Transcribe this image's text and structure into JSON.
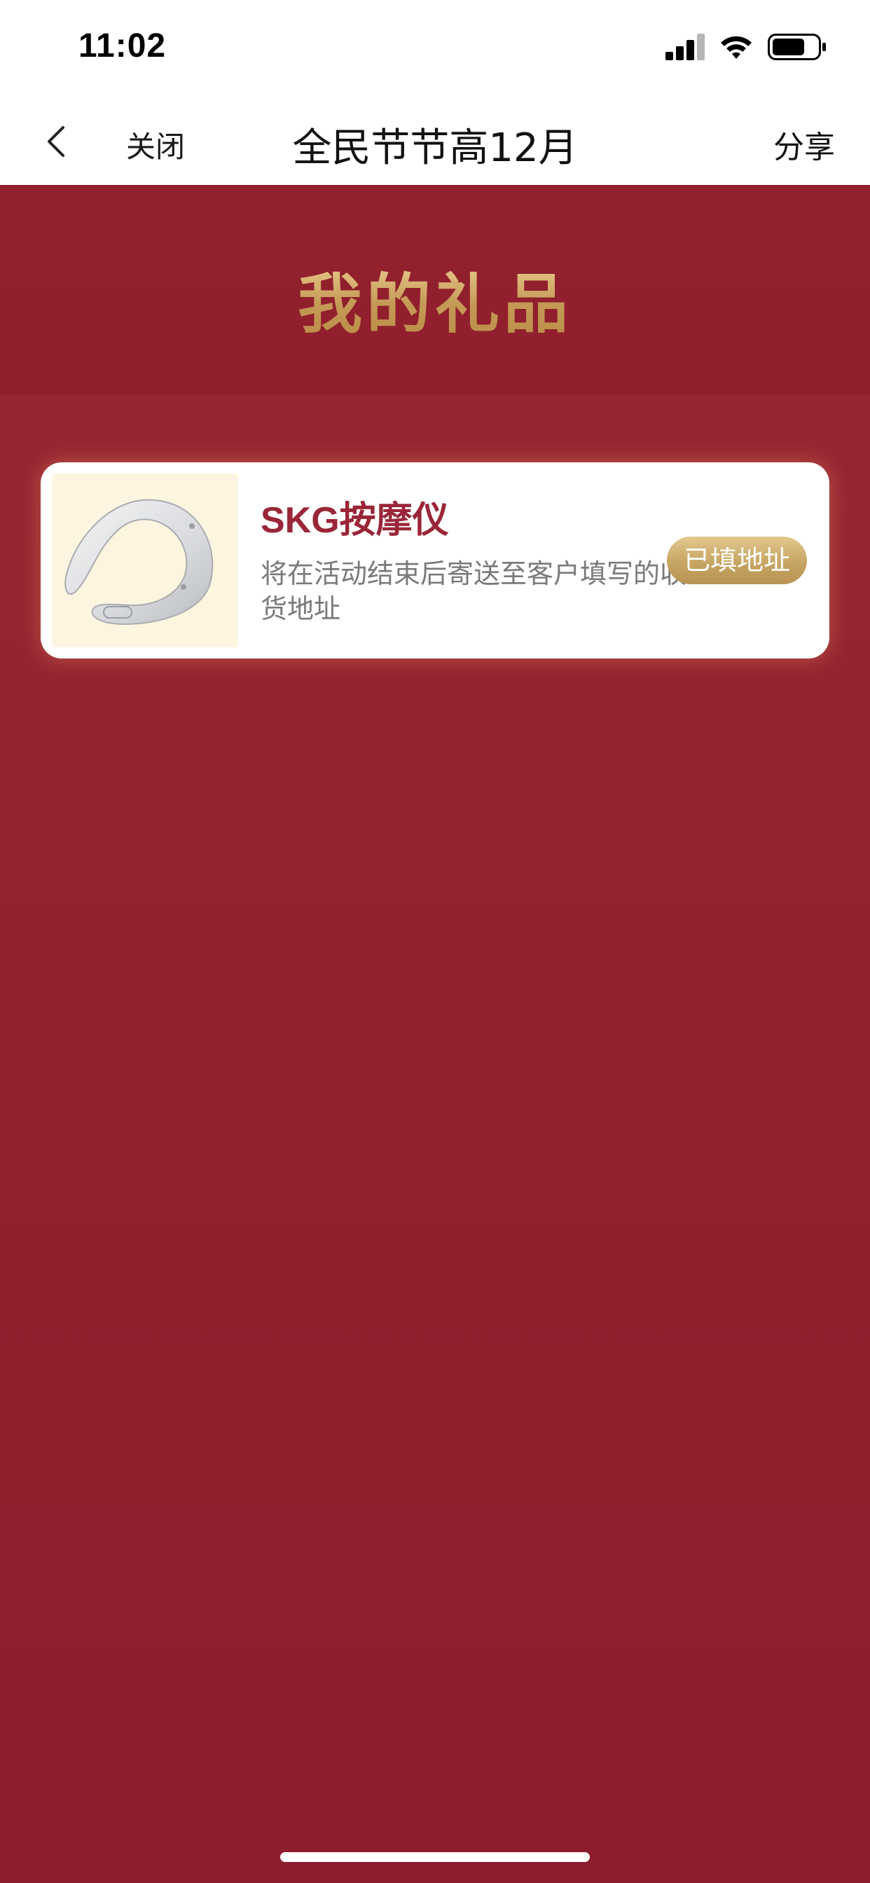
{
  "status_bar": {
    "time": "11:02",
    "signal_icon": "cellular-signal-icon",
    "wifi_icon": "wifi-icon",
    "battery_icon": "battery-icon"
  },
  "nav": {
    "back_icon": "chevron-left-icon",
    "close_label": "关闭",
    "title": "全民节节高12月",
    "share_label": "分享"
  },
  "header": {
    "title": "我的礼品"
  },
  "gifts": [
    {
      "name": "SKG按摩仪",
      "description": "将在活动结束后寄送至客户填写的收货地址",
      "status_button": "已填地址",
      "image_icon": "neck-massager-image"
    }
  ],
  "colors": {
    "background": "#931f31",
    "accent_gold": "#c7a563",
    "gift_name": "#9a2638",
    "thumb_bg": "#fdf5df"
  }
}
